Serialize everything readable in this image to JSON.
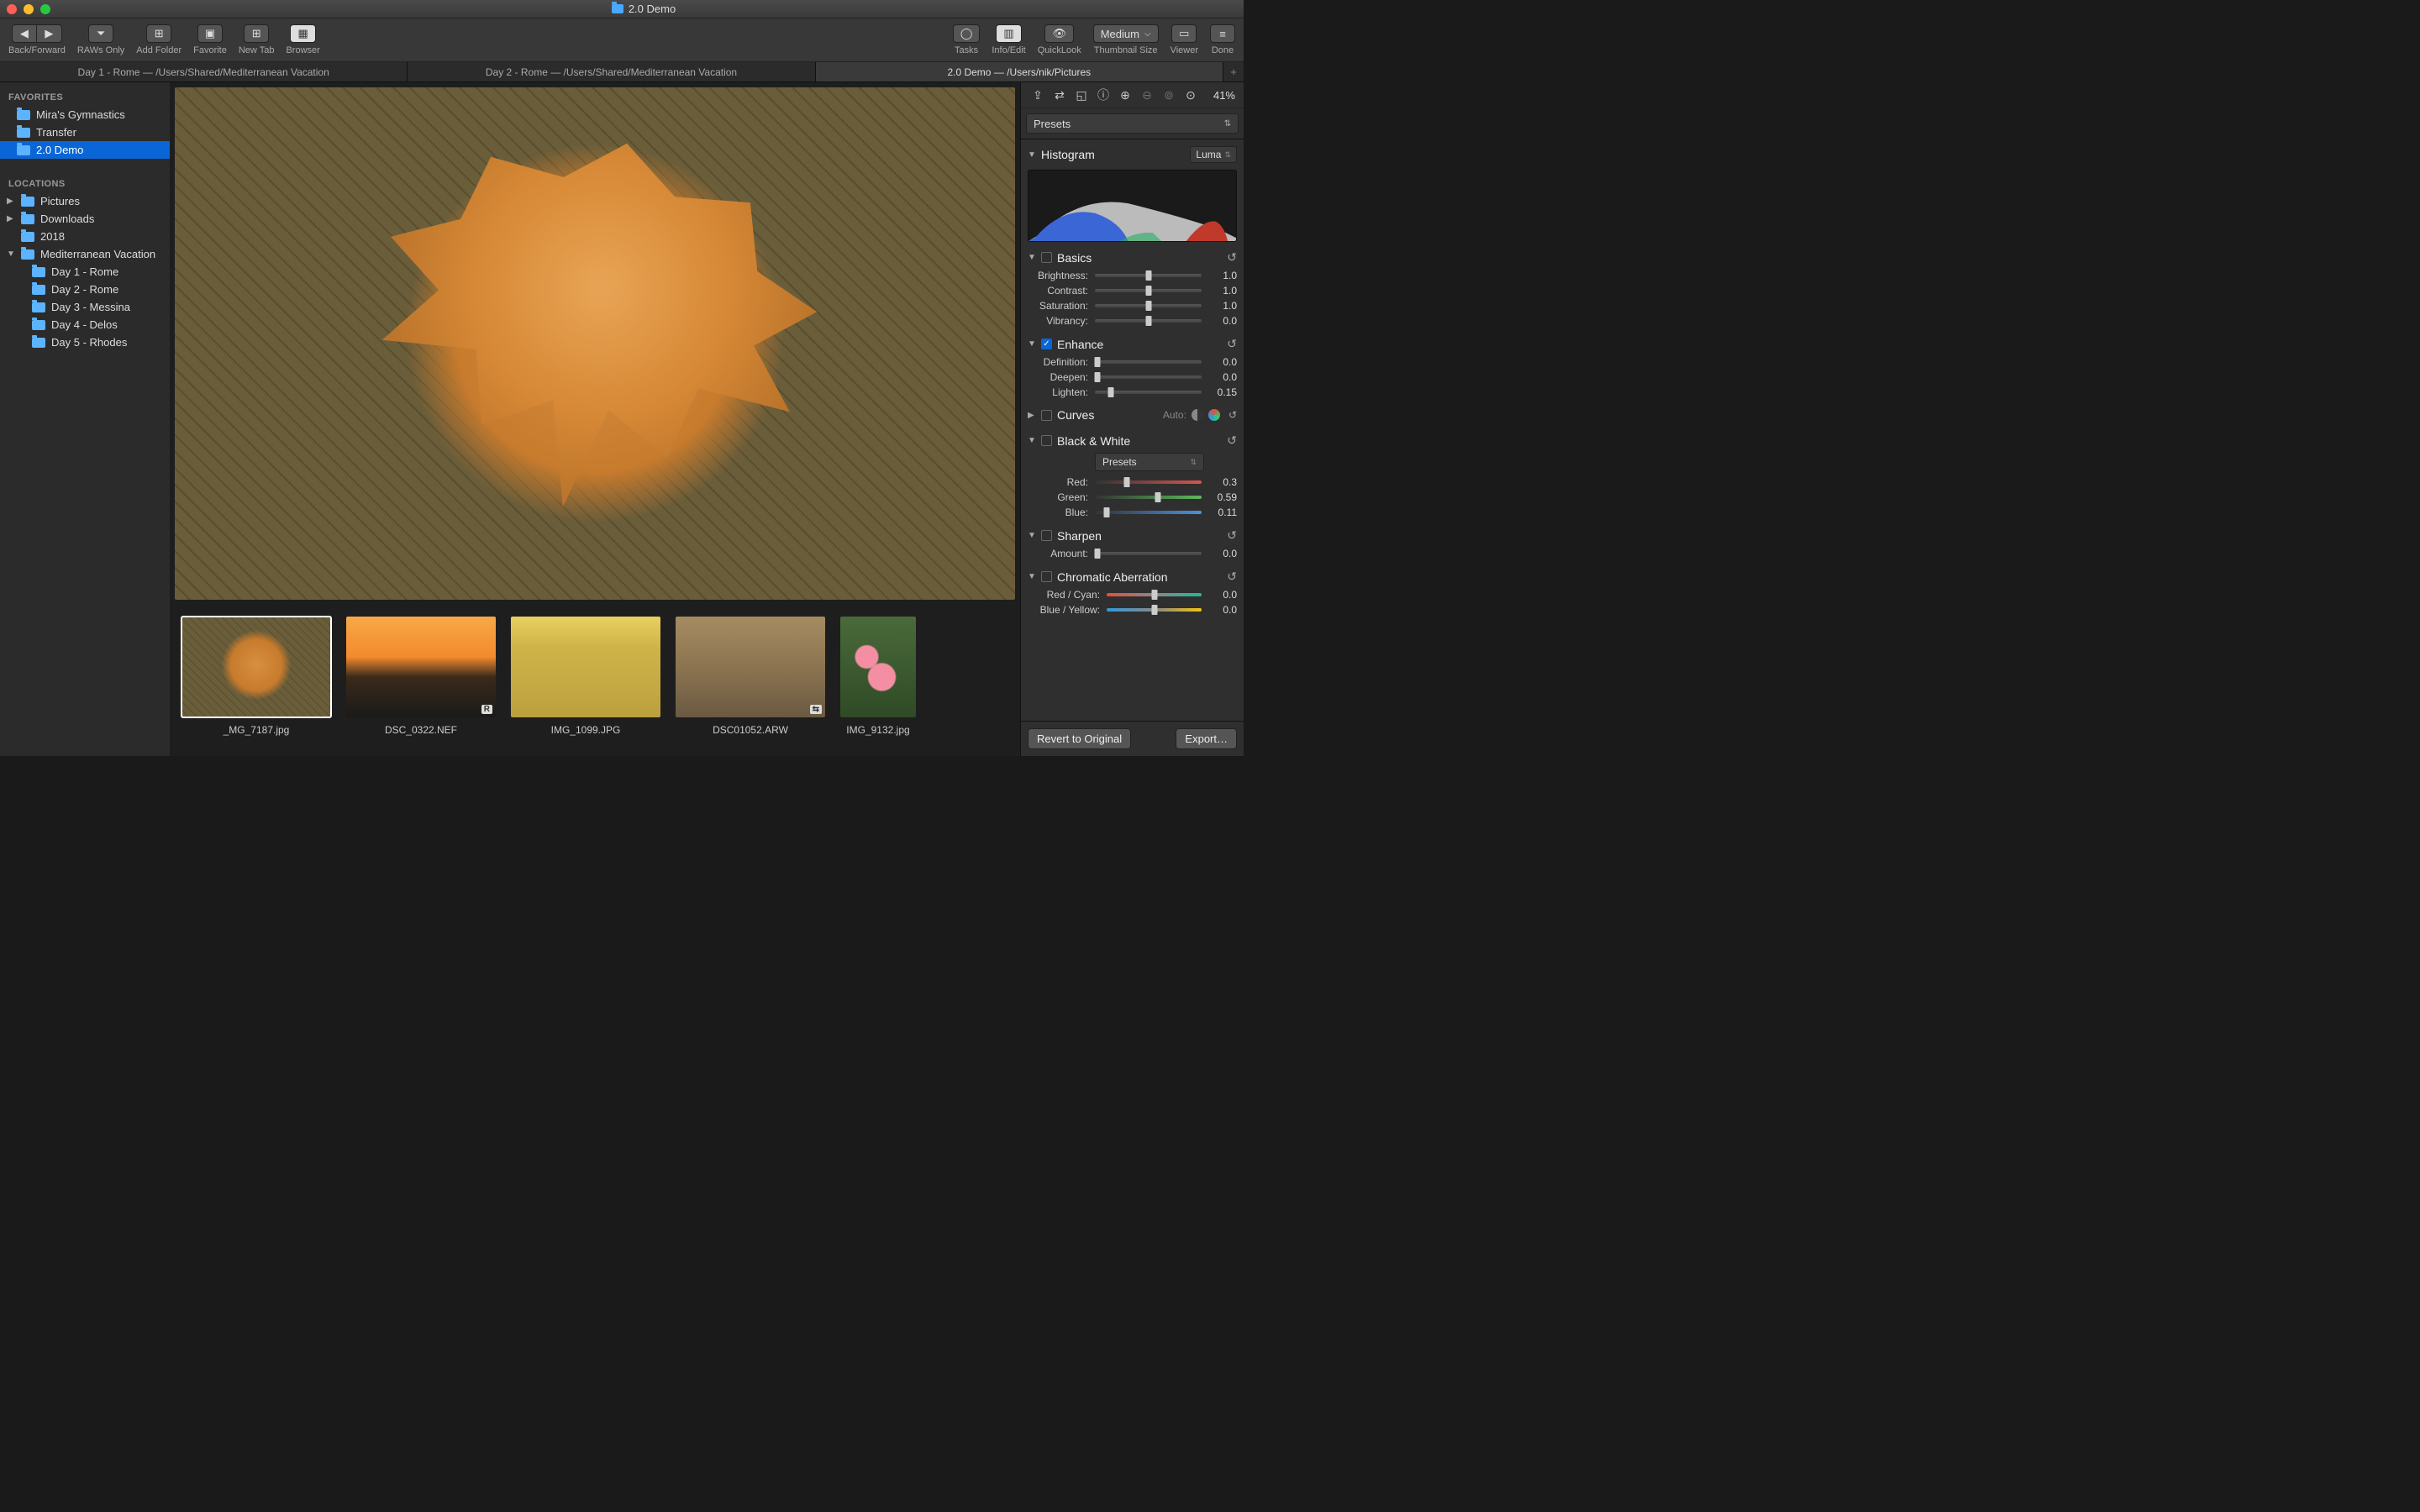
{
  "window": {
    "title": "2.0 Demo"
  },
  "toolbar": {
    "back_forward": "Back/Forward",
    "raws_only": "RAWs Only",
    "add_folder": "Add Folder",
    "favorite": "Favorite",
    "new_tab": "New Tab",
    "browser": "Browser",
    "tasks": "Tasks",
    "info_edit": "Info/Edit",
    "quicklook": "QuickLook",
    "thumbnail_size": "Thumbnail Size",
    "thumbnail_size_value": "Medium",
    "viewer": "Viewer",
    "done": "Done"
  },
  "tabs": [
    {
      "label": "Day 1 - Rome  —  /Users/Shared/Mediterranean Vacation",
      "active": false
    },
    {
      "label": "Day 2 - Rome  —  /Users/Shared/Mediterranean Vacation",
      "active": false
    },
    {
      "label": "2.0 Demo  —  /Users/nik/Pictures",
      "active": true
    }
  ],
  "sidebar": {
    "favorites_header": "FAVORITES",
    "favorites": [
      {
        "name": "Mira's Gymnastics"
      },
      {
        "name": "Transfer"
      },
      {
        "name": "2.0 Demo",
        "selected": true
      }
    ],
    "locations_header": "LOCATIONS",
    "locations": [
      {
        "name": "Pictures",
        "disc": "▶"
      },
      {
        "name": "Downloads",
        "disc": "▶"
      },
      {
        "name": "2018"
      },
      {
        "name": "Mediterranean Vacation",
        "disc": "▼",
        "children": [
          "Day 1 - Rome",
          "Day 2 - Rome",
          "Day 3 - Messina",
          "Day 4 - Delos",
          "Day 5 - Rhodes"
        ]
      }
    ]
  },
  "filmstrip": [
    {
      "file": "_MG_7187.jpg",
      "selected": true,
      "cls": "th0"
    },
    {
      "file": "DSC_0322.NEF",
      "badge": "R",
      "cls": "th1"
    },
    {
      "file": "IMG_1099.JPG",
      "cls": "th2"
    },
    {
      "file": "DSC01052.ARW",
      "badge": "⇆",
      "cls": "th3"
    },
    {
      "file": "IMG_9132.jpg",
      "cls": "th4",
      "narrow": true
    }
  ],
  "panel": {
    "zoom": "41%",
    "presets_label": "Presets",
    "histogram_label": "Histogram",
    "histogram_mode": "Luma",
    "basics": {
      "title": "Basics",
      "brightness_label": "Brightness:",
      "brightness": "1.0",
      "contrast_label": "Contrast:",
      "contrast": "1.0",
      "saturation_label": "Saturation:",
      "saturation": "1.0",
      "vibrancy_label": "Vibrancy:",
      "vibrancy": "0.0"
    },
    "enhance": {
      "title": "Enhance",
      "checked": true,
      "definition_label": "Definition:",
      "definition": "0.0",
      "deepen_label": "Deepen:",
      "deepen": "0.0",
      "lighten_label": "Lighten:",
      "lighten": "0.15"
    },
    "curves": {
      "title": "Curves",
      "auto_label": "Auto:"
    },
    "bw": {
      "title": "Black & White",
      "presets_label": "Presets",
      "red_label": "Red:",
      "red": "0.3",
      "green_label": "Green:",
      "green": "0.59",
      "blue_label": "Blue:",
      "blue": "0.11"
    },
    "sharpen": {
      "title": "Sharpen",
      "amount_label": "Amount:",
      "amount": "0.0"
    },
    "ca": {
      "title": "Chromatic Aberration",
      "rc_label": "Red / Cyan:",
      "rc": "0.0",
      "by_label": "Blue / Yellow:",
      "by": "0.0"
    },
    "footer": {
      "revert": "Revert to Original",
      "export": "Export…"
    }
  }
}
